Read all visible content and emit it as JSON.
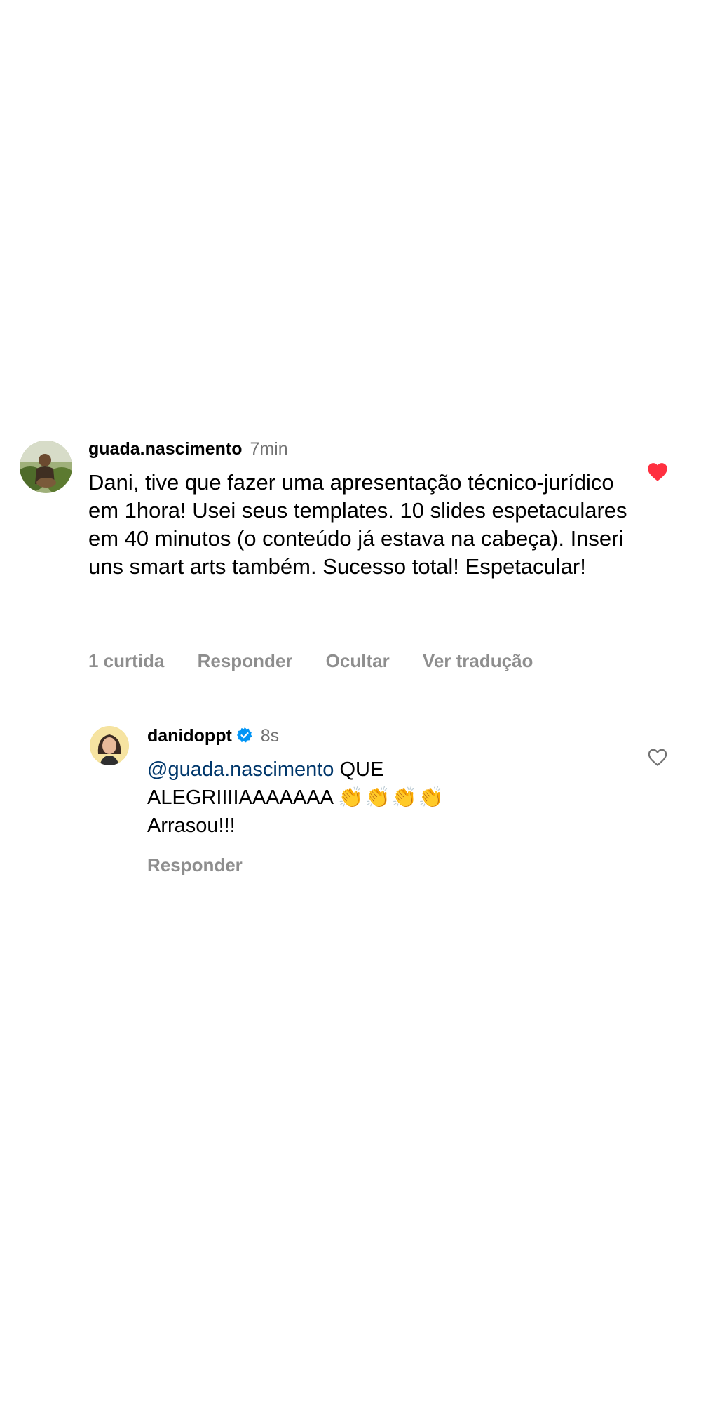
{
  "comments": [
    {
      "username": "guada.nascimento",
      "time": "7min",
      "text": "Dani, tive que fazer uma apresentação técnico-jurídico em 1hora! Usei seus templates. 10 slides espetaculares em 40 minutos (o conteúdo já estava na cabeça). Inseri uns smart arts também. Sucesso total! Espetacular!",
      "likes_label": "1 curtida",
      "reply_label": "Responder",
      "hide_label": "Ocultar",
      "translate_label": "Ver tradução",
      "liked": true,
      "like_icon": "heart-filled-icon"
    }
  ],
  "reply": {
    "username": "danidoppt",
    "verified": true,
    "time": "8s",
    "mention": "@guada.nascimento",
    "text_line1": " QUE",
    "text_line2": "ALEGRIIIIAAAAAAA ",
    "claps": "👏👏👏👏",
    "text_line3": "Arrasou!!!",
    "reply_label": "Responder",
    "liked": false,
    "like_icon": "heart-outline-icon"
  },
  "colors": {
    "like_red": "#ff3040",
    "mention_blue": "#00376b",
    "verified_blue": "#0095f6",
    "secondary_text": "#8e8e8e"
  }
}
